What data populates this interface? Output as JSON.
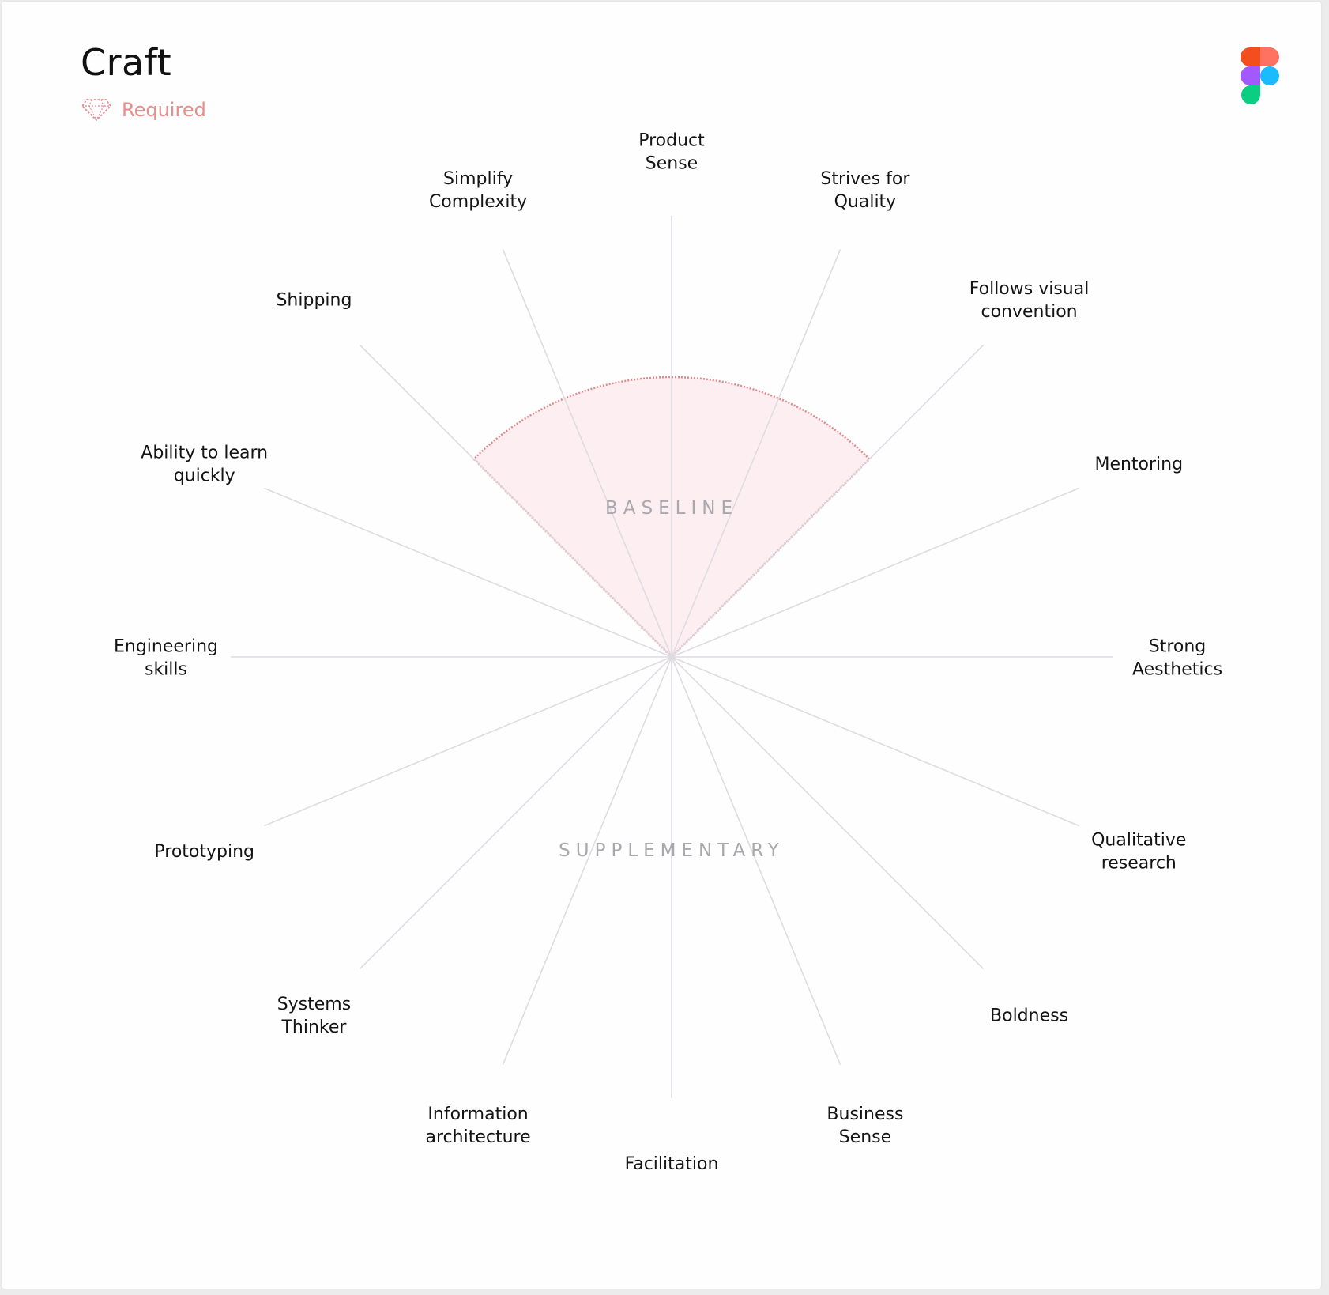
{
  "header": {
    "title": "Craft",
    "badge_label": "Required",
    "badge_icon": "gem-icon",
    "logo_icon": "figma-logo-icon"
  },
  "colors": {
    "accent": "#e88c8c",
    "baseline_fill": "#fdeff1",
    "baseline_stroke": "#e08a8e",
    "spoke": "#dedbe2",
    "figma_red": "#f24e1e",
    "figma_orange": "#ff7262",
    "figma_purple": "#a259ff",
    "figma_blue": "#1abcfe",
    "figma_green": "#0acf83"
  },
  "zones": {
    "baseline": "BASELINE",
    "supplementary": "SUPPLEMENTARY"
  },
  "spokes": [
    {
      "lines": [
        "Product",
        "Sense"
      ]
    },
    {
      "lines": [
        "Strives for",
        "Quality"
      ]
    },
    {
      "lines": [
        "Follows visual",
        "convention"
      ]
    },
    {
      "lines": [
        "Mentoring"
      ]
    },
    {
      "lines": [
        "Strong",
        "Aesthetics"
      ]
    },
    {
      "lines": [
        "Qualitative",
        "research"
      ]
    },
    {
      "lines": [
        "Boldness"
      ]
    },
    {
      "lines": [
        "Business",
        "Sense"
      ]
    },
    {
      "lines": [
        "Facilitation"
      ]
    },
    {
      "lines": [
        "Information",
        "architecture"
      ]
    },
    {
      "lines": [
        "Systems",
        "Thinker"
      ]
    },
    {
      "lines": [
        "Prototyping"
      ]
    },
    {
      "lines": [
        "Engineering",
        "skills"
      ]
    },
    {
      "lines": [
        "Ability to learn",
        "quickly"
      ]
    },
    {
      "lines": [
        "Shipping"
      ]
    },
    {
      "lines": [
        "Simplify",
        "Complexity"
      ]
    }
  ]
}
